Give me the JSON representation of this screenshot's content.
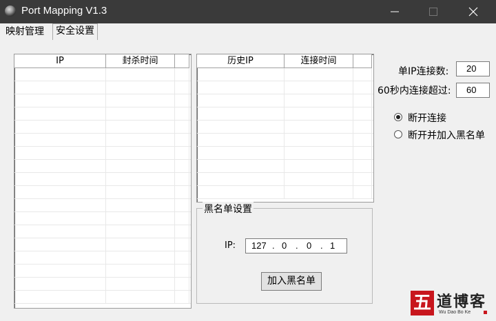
{
  "window": {
    "title": "Port Mapping V1.3",
    "controls": {
      "minimize": "minimize-icon",
      "maximize": "maximize-icon",
      "close": "close-icon"
    }
  },
  "tabs": [
    {
      "label": "映射管理",
      "active": false
    },
    {
      "label": "安全设置",
      "active": true
    }
  ],
  "ban_list": {
    "columns": [
      "IP",
      "封杀时间",
      ""
    ],
    "rows": []
  },
  "history_list": {
    "columns": [
      "历史IP",
      "连接时间",
      ""
    ],
    "rows": []
  },
  "settings": {
    "per_ip_label": "单IP连接数:",
    "per_ip_value": "20",
    "window_label": "60秒内连接超过:",
    "window_value": "60"
  },
  "action": {
    "options": [
      {
        "label": "断开连接",
        "selected": true
      },
      {
        "label": "断开并加入黑名单",
        "selected": false
      }
    ]
  },
  "blacklist": {
    "group_title": "黑名单设置",
    "ip_label": "IP:",
    "ip": [
      "127",
      "0",
      "0",
      "1"
    ],
    "add_button": "加入黑名单"
  },
  "watermark": {
    "seal": "五",
    "text": "道博客",
    "sub": "Wu Dao Bo Ke"
  },
  "colors": {
    "titlebar": "#3a3a3a",
    "window_bg": "#f0f0f0",
    "watermark_red": "#c8161d"
  }
}
